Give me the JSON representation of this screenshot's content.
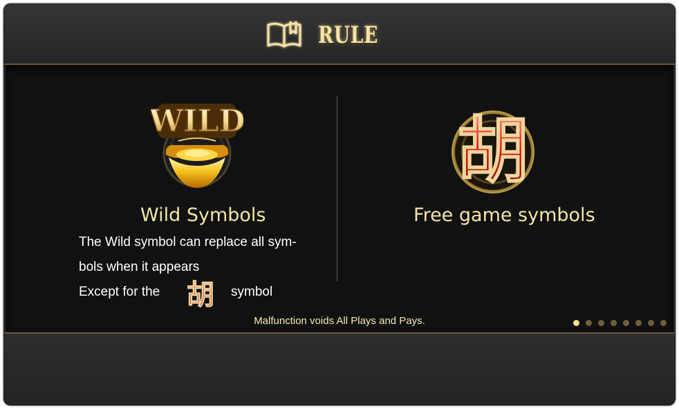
{
  "header": {
    "title": "RULE",
    "icon": "book-icon"
  },
  "wild": {
    "heading": "Wild Symbols",
    "line1": "The Wild symbol can replace all sym-",
    "line2": "bols when it appears",
    "line3_prefix": "Except for the",
    "line3_suffix": "symbol",
    "icon_text": "WILD",
    "icon": "wild-gold-ingot-icon"
  },
  "free": {
    "heading": "Free game symbols",
    "glyph": "胡",
    "icon": "hu-character-icon"
  },
  "footer": {
    "notice": "Malfunction voids All Plays and Pays."
  },
  "pagination": {
    "total": 8,
    "active_index": 0
  }
}
